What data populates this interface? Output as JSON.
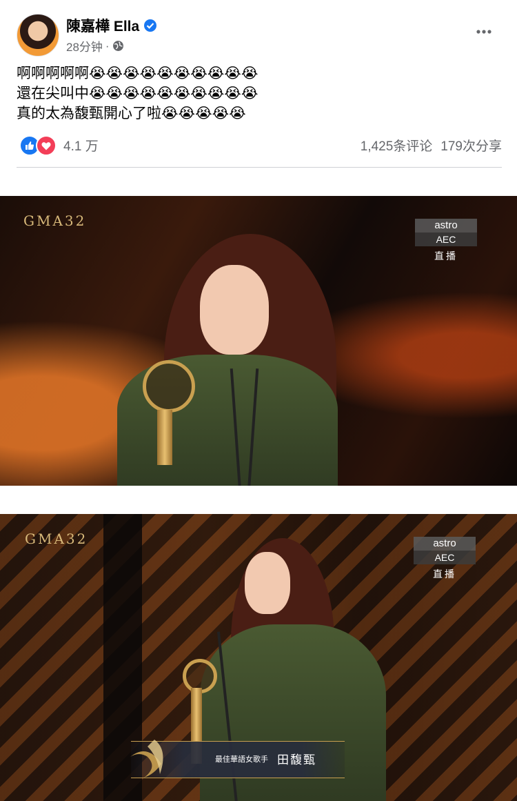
{
  "post": {
    "author": "陳嘉樺 Ella",
    "time": "28分钟",
    "meta_separator": "·",
    "lines": [
      "啊啊啊啊啊",
      "還在尖叫中",
      "真的太為馥甄開心了啦"
    ],
    "emoji_counts": [
      10,
      10,
      5
    ],
    "emoji": "😭",
    "reaction_count": "4.1 万",
    "comments": "1,425条评论",
    "shares": "179次分享"
  },
  "photos": [
    {
      "logo": "GMA32",
      "badge_top": "astro",
      "badge_mid": "AEC",
      "badge_bottom": "直播"
    },
    {
      "logo": "GMA32",
      "badge_top": "astro",
      "badge_mid": "AEC",
      "badge_bottom": "直播",
      "award_title": "最佳華語女歌手",
      "winner": "田馥甄"
    }
  ],
  "colors": {
    "like": "#1877f2",
    "love": "#f33e58",
    "secondary_text": "#65676b",
    "gold": "#c9a050"
  }
}
